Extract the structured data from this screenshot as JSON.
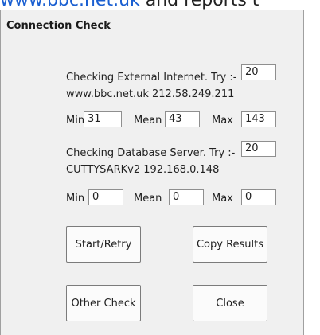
{
  "snippet": {
    "link": "www.bbc.net.uk",
    "text": " and reports t"
  },
  "dialog": {
    "title": "Connection Check",
    "external": {
      "label_line1": "Checking External Internet. Try :-",
      "label_line2": "www.bbc.net.uk 212.58.249.211",
      "tries": "20",
      "min_label": "Min",
      "min": "31",
      "mean_label": "Mean",
      "mean": "43",
      "max_label": "Max",
      "max": "143"
    },
    "database": {
      "label_line1": "Checking Database Server. Try :-",
      "label_line2": "CUTTYSARKv2 192.168.0.148",
      "tries": "20",
      "min_label": "Min",
      "min": "0",
      "mean_label": "Mean",
      "mean": "0",
      "max_label": "Max",
      "max": "0"
    },
    "buttons": {
      "start_retry": "Start/Retry",
      "copy_results": "Copy Results",
      "other_check": "Other Check",
      "close": "Close"
    }
  }
}
